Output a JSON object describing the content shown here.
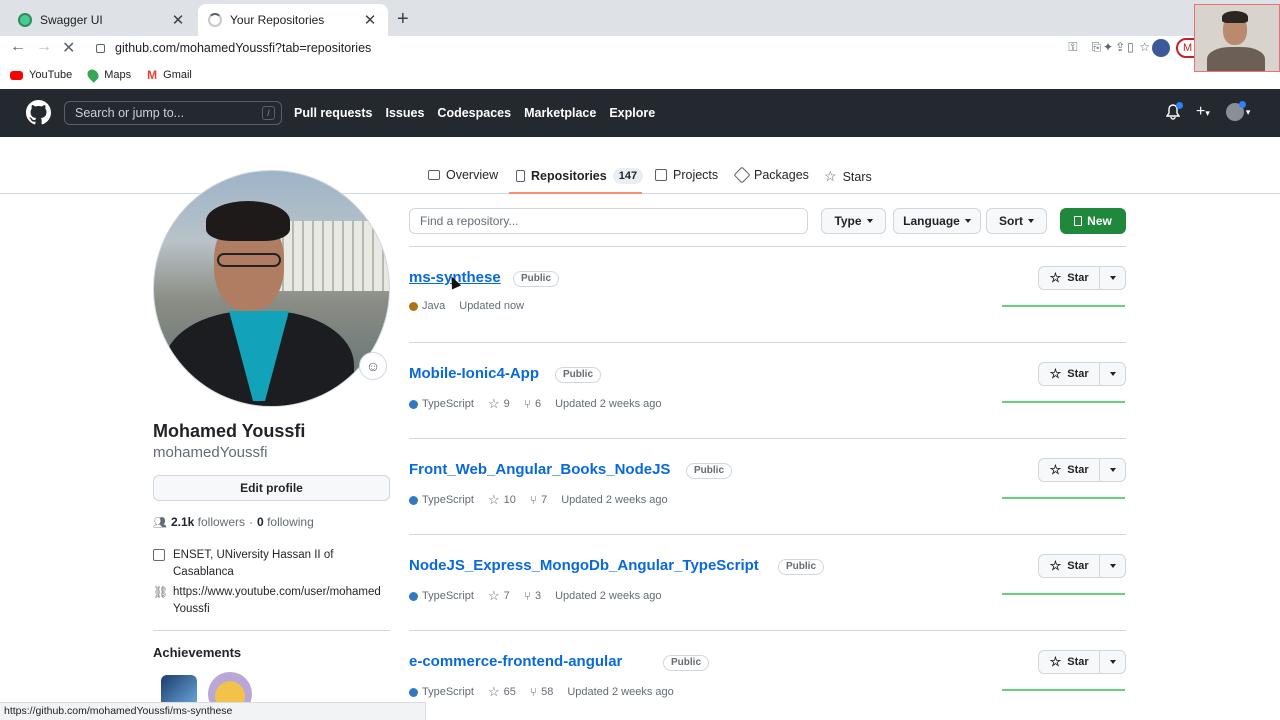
{
  "browser": {
    "tabs": [
      {
        "title": "Swagger UI",
        "favicon": "swagger-icon",
        "active": false
      },
      {
        "title": "Your Repositories",
        "favicon": "loading-spinner-icon",
        "active": true
      }
    ],
    "url": "github.com/mohamedYoussfi?tab=repositories",
    "bookmarks": [
      "YouTube",
      "Maps",
      "Gmail"
    ],
    "profile_initial": "M"
  },
  "github": {
    "search_placeholder": "Search or jump to...",
    "search_shortcut": "/",
    "nav": [
      "Pull requests",
      "Issues",
      "Codespaces",
      "Marketplace",
      "Explore"
    ],
    "profile_tabs": {
      "overview": "Overview",
      "repositories": "Repositories",
      "repositories_count": "147",
      "projects": "Projects",
      "packages": "Packages",
      "stars": "Stars"
    },
    "user": {
      "full_name": "Mohamed Youssfi",
      "login": "mohamedYoussfi",
      "edit_label": "Edit profile",
      "followers": "2.1k",
      "followers_label": "followers",
      "separator": "·",
      "following": "0",
      "following_label": "following",
      "organization": "ENSET, UNiversity Hassan II of Casablanca",
      "website": "https://www.youtube.com/user/mohamedYoussfi",
      "achievements_label": "Achievements"
    },
    "repo_filters": {
      "search_placeholder": "Find a repository...",
      "type": "Type",
      "language": "Language",
      "sort": "Sort",
      "new": "New"
    },
    "repos": [
      {
        "name": "ms-synthese",
        "visibility": "Public",
        "language": "Java",
        "lang_color": "#b07219",
        "stars": "",
        "forks": "",
        "updated": "Updated now",
        "star_label": "Star"
      },
      {
        "name": "Mobile-Ionic4-App",
        "visibility": "Public",
        "language": "TypeScript",
        "lang_color": "#3178c6",
        "stars": "9",
        "forks": "6",
        "updated": "Updated 2 weeks ago",
        "star_label": "Star"
      },
      {
        "name": "Front_Web_Angular_Books_NodeJS",
        "visibility": "Public",
        "language": "TypeScript",
        "lang_color": "#3178c6",
        "stars": "10",
        "forks": "7",
        "updated": "Updated 2 weeks ago",
        "star_label": "Star"
      },
      {
        "name": "NodeJS_Express_MongoDb_Angular_TypeScript",
        "visibility": "Public",
        "language": "TypeScript",
        "lang_color": "#3178c6",
        "stars": "7",
        "forks": "3",
        "updated": "Updated 2 weeks ago",
        "star_label": "Star"
      },
      {
        "name": "e-commerce-frontend-angular",
        "visibility": "Public",
        "language": "TypeScript",
        "lang_color": "#3178c6",
        "stars": "65",
        "forks": "58",
        "updated": "Updated 2 weeks ago",
        "star_label": "Star"
      }
    ],
    "status_url": "https://github.com/mohamedYoussfi/ms-synthese"
  }
}
